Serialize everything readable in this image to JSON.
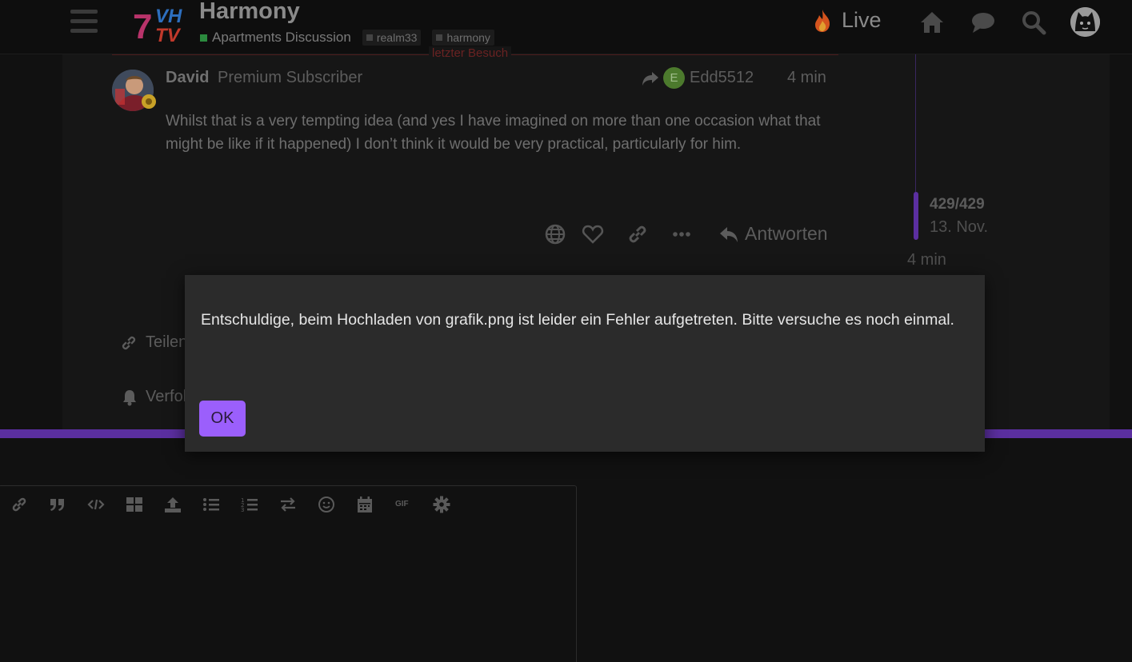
{
  "header": {
    "topic_title": "Harmony",
    "category": "Apartments Discussion",
    "tags": [
      "realm33",
      "harmony"
    ],
    "live_label": "Live",
    "logo_text": "VH TV",
    "icons": [
      "menu-icon",
      "home-icon",
      "chat-icon",
      "search-icon",
      "user-avatar"
    ]
  },
  "post": {
    "last_visit_label": "letzter Besuch",
    "author": "David",
    "author_title": "Premium Subscriber",
    "reply_to_initial": "E",
    "reply_to_user": "Edd5512",
    "time": "4 min",
    "body": "Whilst that is a very tempting idea (and yes I have imagined on more than one occasion what that might be like if it happened) I don’t think it would be very practical, particularly for him.",
    "reply_label": "Antworten"
  },
  "timeline": {
    "count": "429/429",
    "date": "13. Nov.",
    "ago": "4 min"
  },
  "footer_buttons": {
    "share": "Teilen",
    "follow": "Verfolgen"
  },
  "composer": {
    "toolbar": [
      "link",
      "quote",
      "code",
      "grid",
      "upload",
      "bullet-list",
      "numbered-list",
      "toggle-direction",
      "emoji",
      "calendar",
      "gif",
      "options"
    ],
    "gif_label": "GIF"
  },
  "modal": {
    "message": "Entschuldige, beim Hochladen von grafik.png ist leider ein Fehler aufgetreten. Bitte versuche es noch einmal.",
    "ok_label": "OK"
  },
  "colors": {
    "accent": "#9b5ffc",
    "composer_bar": "#5b2fa0",
    "category": "#2b8a3e"
  }
}
